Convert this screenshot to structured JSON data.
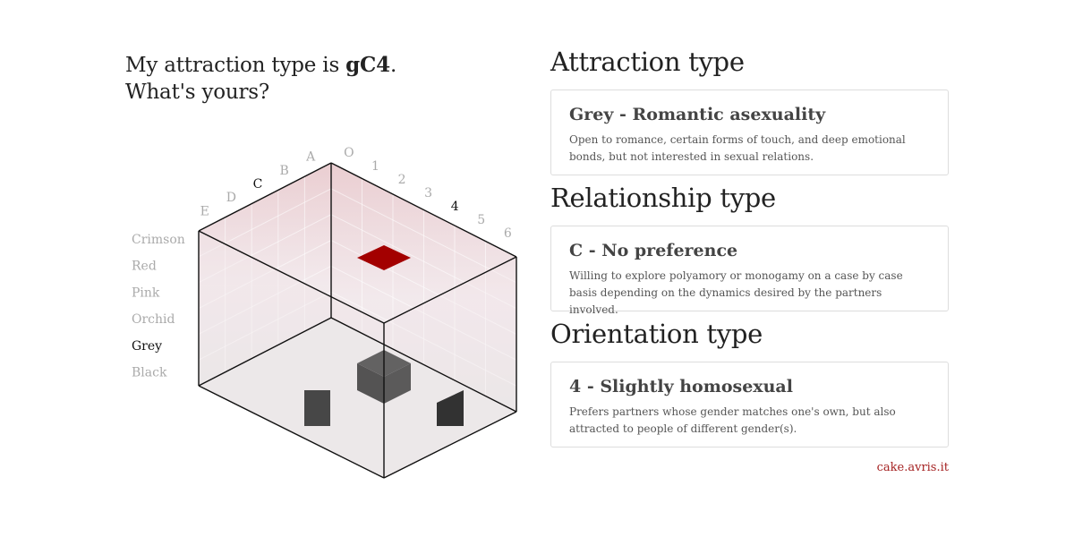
{
  "headline": {
    "prefix": "My attraction type is ",
    "code": "gC4",
    "suffix": ".",
    "line2": "What's yours?"
  },
  "cube": {
    "letters": [
      "A",
      "B",
      "C",
      "D",
      "E"
    ],
    "selected_letter": "C",
    "numbers": [
      "O",
      "1",
      "2",
      "3",
      "4",
      "5",
      "6"
    ],
    "selected_number": "4",
    "colors": [
      "Crimson",
      "Red",
      "Pink",
      "Orchid",
      "Grey",
      "Black"
    ],
    "selected_color": "Grey",
    "accent_color": "#a30000",
    "grey_color": "#2b2b2b"
  },
  "attraction": {
    "heading": "Attraction type",
    "title": "Grey - Romantic asexuality",
    "description": "Open to romance, certain forms of touch, and deep emotional bonds, but not interested in sexual relations."
  },
  "relationship": {
    "heading": "Relationship type",
    "title": "C - No preference",
    "description": "Willing to explore polyamory or monogamy on a case by case basis depending on the dynamics desired by the partners involved."
  },
  "orientation": {
    "heading": "Orientation type",
    "title": "4 - Slightly homosexual",
    "description": "Prefers partners whose gender matches one's own, but also attracted to people of different gender(s)."
  },
  "footer": {
    "link_text": "cake.avris.it",
    "link_color": "#a52222"
  }
}
